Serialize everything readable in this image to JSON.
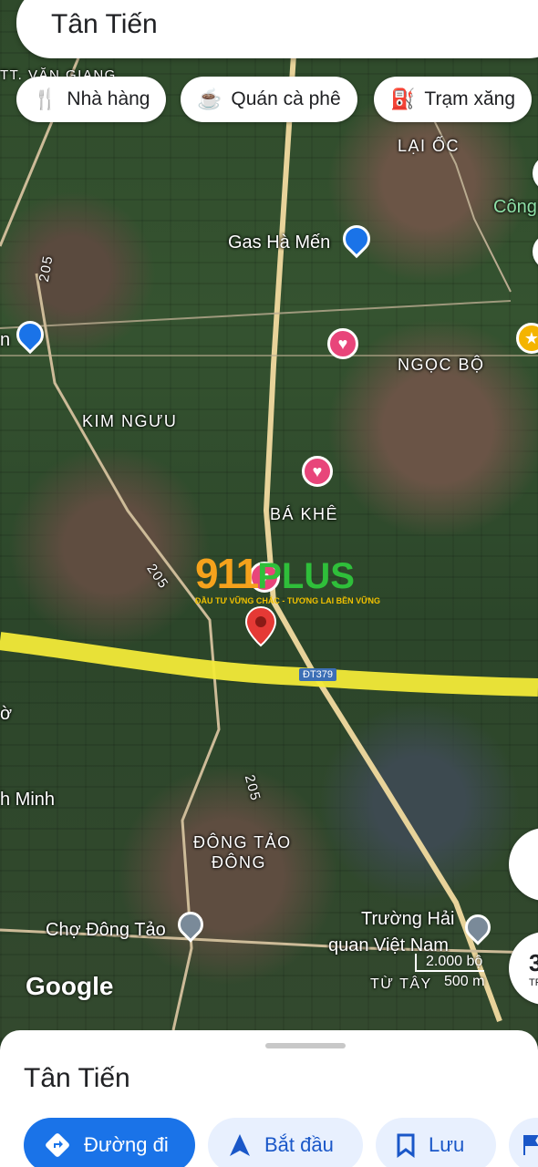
{
  "search": {
    "query": "Tân Tiến"
  },
  "chips": [
    {
      "label": "Nhà hàng",
      "icon": "restaurant-icon"
    },
    {
      "label": "Quán cà phê",
      "icon": "coffee-icon"
    },
    {
      "label": "Trạm xăng",
      "icon": "gas-station-icon"
    }
  ],
  "map": {
    "labels": {
      "tt_van_giang": "TT. VĂN GIANG",
      "lai_oc": "LẠI ỐC",
      "cong": "Công",
      "gas_ha_men": "Gas Hà Mến",
      "ngoc_bo": "NGỌC BỘ",
      "kim_nguu": "KIM NGƯU",
      "ba_khe": "BÁ KHÊ",
      "road_205_a": "205",
      "road_205_b": "205",
      "road_205_c": "205",
      "road_dt379": "ĐT379",
      "minh": "h Minh",
      "dong_tao_dong_1": "ĐÔNG TẢO",
      "dong_tao_dong_2": "ĐÔNG",
      "cho_dong_tao": "Chợ Đông Tảo",
      "truong_hai_quan_1": "Trường Hải",
      "truong_hai_quan_2": "quan Việt Nam",
      "tu_tay": "TỪ TÂY",
      "edge_n": "n",
      "edge_o": "ờ"
    },
    "google_logo": "Google",
    "scale": {
      "top": "2.000 bộ",
      "bottom": "500 m"
    },
    "side_right_tr": "TR",
    "side_right_3": "3"
  },
  "watermark": {
    "brand_num": "911",
    "brand_text": "PLUS",
    "tagline": "ĐẦU TƯ VỮNG CHẮC - TƯƠNG LAI BỀN VỮNG"
  },
  "sheet": {
    "title": "Tân Tiến",
    "buttons": [
      {
        "label": "Đường đi"
      },
      {
        "label": "Bắt đầu"
      },
      {
        "label": "Lưu"
      }
    ]
  },
  "colors": {
    "route": "#f2ea38",
    "primary": "#1a73e8",
    "pin_red": "#e53935",
    "fav_pink": "#e8457a"
  }
}
